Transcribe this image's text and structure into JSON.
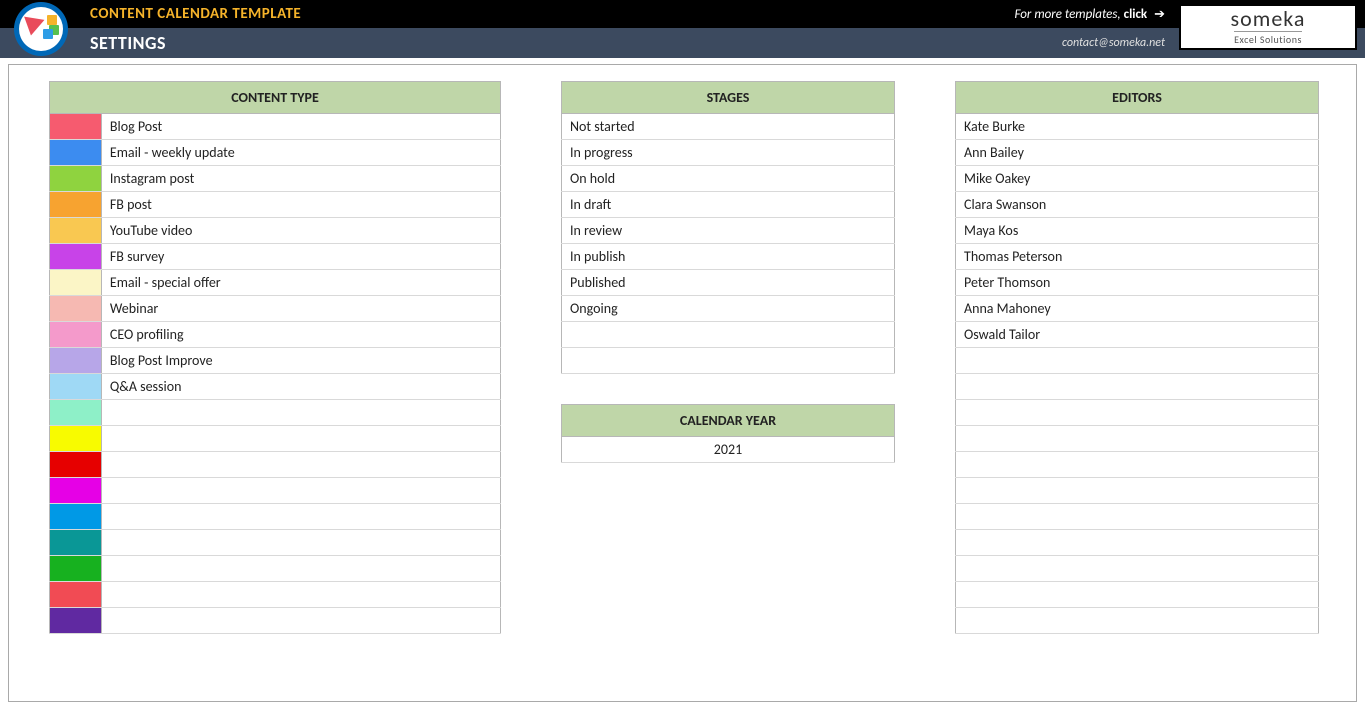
{
  "header": {
    "title": "CONTENT CALENDAR TEMPLATE",
    "more_text": "For more templates,",
    "click_text": "click",
    "subtitle": "SETTINGS",
    "email": "contact@someka.net",
    "brand_name": "someka",
    "brand_sub": "Excel Solutions"
  },
  "content_type": {
    "heading": "CONTENT TYPE",
    "rows": [
      {
        "color": "#f65b6f",
        "label": "Blog Post"
      },
      {
        "color": "#3c8cf0",
        "label": "Email - weekly update"
      },
      {
        "color": "#8fd33f",
        "label": "Instagram post"
      },
      {
        "color": "#f7a330",
        "label": "FB post"
      },
      {
        "color": "#f9c851",
        "label": "YouTube video"
      },
      {
        "color": "#c843e8",
        "label": "FB survey"
      },
      {
        "color": "#fbf5c6",
        "label": "Email - special offer"
      },
      {
        "color": "#f6b9b2",
        "label": "Webinar"
      },
      {
        "color": "#f49acb",
        "label": "CEO profiling"
      },
      {
        "color": "#b7a6e8",
        "label": "Blog Post Improve"
      },
      {
        "color": "#9fd9f5",
        "label": "Q&A session"
      },
      {
        "color": "#8ef0c8",
        "label": ""
      },
      {
        "color": "#f8fb00",
        "label": ""
      },
      {
        "color": "#e60000",
        "label": ""
      },
      {
        "color": "#e600e6",
        "label": ""
      },
      {
        "color": "#0099e6",
        "label": ""
      },
      {
        "color": "#0a9796",
        "label": ""
      },
      {
        "color": "#17b11f",
        "label": ""
      },
      {
        "color": "#f14b54",
        "label": ""
      },
      {
        "color": "#6029a1",
        "label": ""
      }
    ]
  },
  "stages": {
    "heading": "STAGES",
    "rows": [
      "Not started",
      "In progress",
      "On hold",
      "In draft",
      "In review",
      "In publish",
      "Published",
      "Ongoing",
      "",
      ""
    ]
  },
  "calendar_year": {
    "heading": "CALENDAR YEAR",
    "value": "2021"
  },
  "editors": {
    "heading": "EDITORS",
    "rows": [
      "Kate Burke",
      "Ann Bailey",
      "Mike Oakey",
      "Clara Swanson",
      "Maya Kos",
      "Thomas Peterson",
      "Peter Thomson",
      "Anna Mahoney",
      "Oswald Tailor",
      "",
      "",
      "",
      "",
      "",
      "",
      "",
      "",
      "",
      "",
      ""
    ]
  }
}
